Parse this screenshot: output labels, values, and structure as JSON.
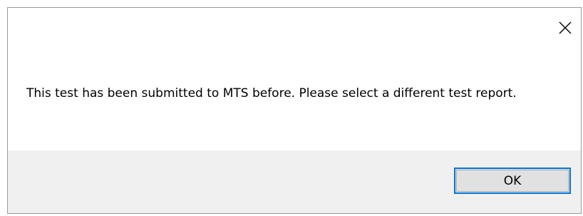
{
  "dialog": {
    "message": "This test has been submitted to MTS before. Please select a different test report.",
    "close_icon": "close-icon",
    "ok_label": "OK",
    "accent_color": "#0078d7",
    "button_bar_color": "#f0f0f0"
  }
}
